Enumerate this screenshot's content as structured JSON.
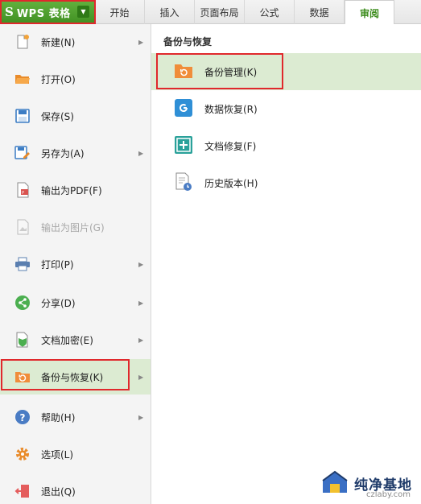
{
  "app": {
    "logo": "S",
    "name": "WPS 表格"
  },
  "tabs": [
    {
      "label": "开始"
    },
    {
      "label": "插入"
    },
    {
      "label": "页面布局"
    },
    {
      "label": "公式"
    },
    {
      "label": "数据"
    },
    {
      "label": "审阅",
      "active": true
    }
  ],
  "menu": {
    "items": [
      {
        "label": "新建(N)",
        "icon": "new-file-icon",
        "has_submenu": true
      },
      {
        "label": "打开(O)",
        "icon": "open-folder-icon",
        "has_submenu": false
      },
      {
        "label": "保存(S)",
        "icon": "save-icon",
        "has_submenu": false
      },
      {
        "label": "另存为(A)",
        "icon": "save-as-icon",
        "has_submenu": true
      },
      {
        "label": "输出为PDF(F)",
        "icon": "pdf-icon",
        "has_submenu": false
      },
      {
        "label": "输出为图片(G)",
        "icon": "image-export-icon",
        "has_submenu": false,
        "disabled": true
      },
      {
        "label": "打印(P)",
        "icon": "print-icon",
        "has_submenu": true
      },
      {
        "label": "分享(D)",
        "icon": "share-icon",
        "has_submenu": true
      },
      {
        "label": "文档加密(E)",
        "icon": "encrypt-icon",
        "has_submenu": true
      },
      {
        "label": "备份与恢复(K)",
        "icon": "backup-icon",
        "has_submenu": true,
        "selected": true
      },
      {
        "label": "帮助(H)",
        "icon": "help-icon",
        "has_submenu": true
      },
      {
        "label": "选项(L)",
        "icon": "options-gear-icon",
        "has_submenu": false
      },
      {
        "label": "退出(Q)",
        "icon": "exit-icon",
        "has_submenu": false
      }
    ]
  },
  "panel": {
    "title": "备份与恢复",
    "items": [
      {
        "label": "备份管理(K)",
        "icon": "backup-manage-icon",
        "selected": true
      },
      {
        "label": "数据恢复(R)",
        "icon": "data-recovery-icon"
      },
      {
        "label": "文档修复(F)",
        "icon": "doc-repair-icon"
      },
      {
        "label": "历史版本(H)",
        "icon": "history-version-icon"
      }
    ]
  },
  "watermark": {
    "text": "纯净基地",
    "url": "czlaby.com"
  },
  "colors": {
    "brand_green": "#4a9e2a",
    "selection_bg": "#dcebd2",
    "highlight_red": "#e0282c",
    "active_tab_text": "#3c8c1c"
  }
}
